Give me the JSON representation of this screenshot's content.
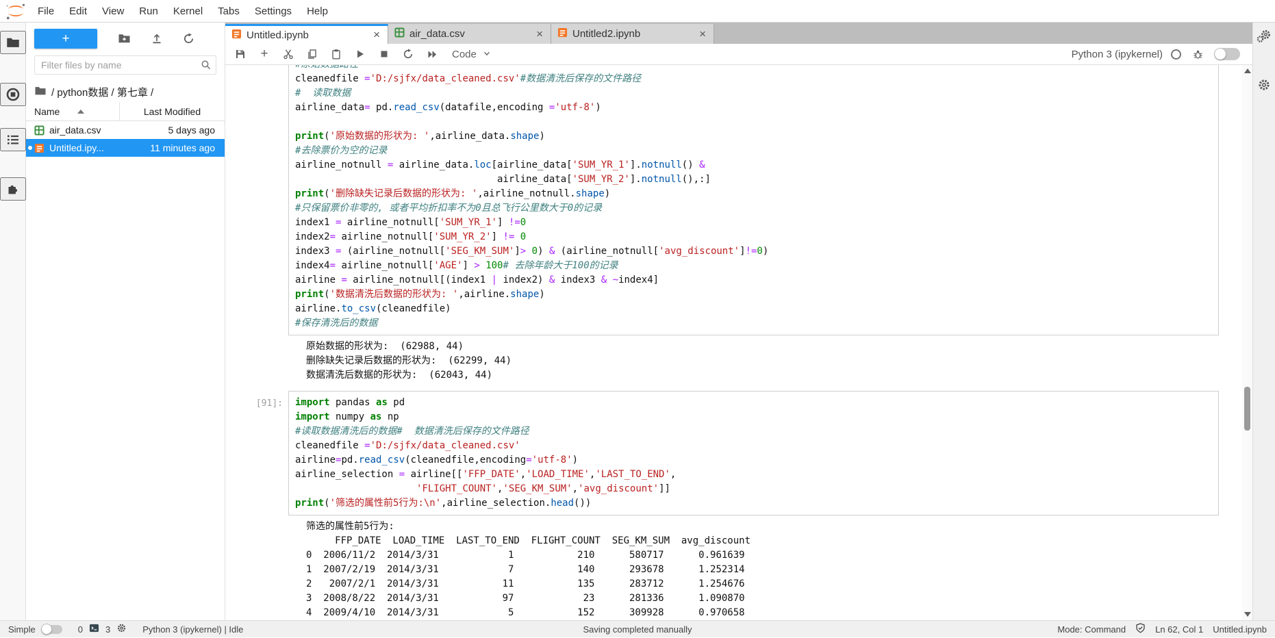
{
  "colors": {
    "accent": "#2196F3",
    "notebook_icon": "#F37626",
    "csv_icon": "#388E3C",
    "kw": "#008000",
    "str": "#BA2121",
    "cmt": "#408080",
    "op": "#AA22FF",
    "num": "#008800",
    "prop": "#0055AA"
  },
  "menu": {
    "items": [
      "File",
      "Edit",
      "View",
      "Run",
      "Kernel",
      "Tabs",
      "Settings",
      "Help"
    ]
  },
  "sidebar": {
    "filter_placeholder": "Filter files by name",
    "breadcrumb": "/ python数据 / 第七章 /",
    "columns": {
      "name": "Name",
      "modified": "Last Modified"
    },
    "files": [
      {
        "name": "air_data.csv",
        "modified": "5 days ago",
        "icon": "csv",
        "selected": false,
        "running": false
      },
      {
        "name": "Untitled.ipy...",
        "modified": "11 minutes ago",
        "icon": "notebook",
        "selected": true,
        "running": true
      }
    ]
  },
  "tabs": [
    {
      "label": "Untitled.ipynb",
      "icon": "notebook",
      "active": true,
      "close": "×"
    },
    {
      "label": "air_data.csv",
      "icon": "csv",
      "active": false,
      "close": "×"
    },
    {
      "label": "Untitled2.ipynb",
      "icon": "notebook",
      "active": false,
      "close": "×"
    }
  ],
  "toolbar": {
    "cell_type": "Code",
    "kernel": "Python 3 (ipykernel)"
  },
  "notebook": {
    "cells": [
      {
        "prompt": "",
        "clip_top": true,
        "lines": [
          [
            [
              "c",
              "#原始数据路径"
            ]
          ],
          [
            [
              "t",
              "cleanedfile "
            ],
            [
              "o",
              "="
            ],
            [
              "s",
              "'D:/sjfx/data_cleaned.csv'"
            ],
            [
              "c",
              "#数据清洗后保存的文件路径"
            ]
          ],
          [
            [
              "c",
              "#  读取数据"
            ]
          ],
          [
            [
              "t",
              "airline_data"
            ],
            [
              "o",
              "="
            ],
            [
              "t",
              " pd."
            ],
            [
              "p",
              "read_csv"
            ],
            [
              "t",
              "(datafile,encoding "
            ],
            [
              "o",
              "="
            ],
            [
              "s",
              "'utf-8'"
            ],
            [
              "t",
              ")"
            ]
          ],
          [
            [
              "t",
              ""
            ]
          ],
          [
            [
              "k",
              "print"
            ],
            [
              "t",
              "("
            ],
            [
              "s",
              "'原始数据的形状为: '"
            ],
            [
              "t",
              ",airline_data."
            ],
            [
              "p",
              "shape"
            ],
            [
              "t",
              ")"
            ]
          ],
          [
            [
              "c",
              "#去除票价为空的记录"
            ]
          ],
          [
            [
              "t",
              "airline_notnull "
            ],
            [
              "o",
              "="
            ],
            [
              "t",
              " airline_data."
            ],
            [
              "p",
              "loc"
            ],
            [
              "t",
              "[airline_data["
            ],
            [
              "s",
              "'SUM_YR_1'"
            ],
            [
              "t",
              "]."
            ],
            [
              "p",
              "notnull"
            ],
            [
              "t",
              "() "
            ],
            [
              "o",
              "&"
            ]
          ],
          [
            [
              "t",
              "                                   airline_data["
            ],
            [
              "s",
              "'SUM_YR_2'"
            ],
            [
              "t",
              "]."
            ],
            [
              "p",
              "notnull"
            ],
            [
              "t",
              "(),:]"
            ]
          ],
          [
            [
              "k",
              "print"
            ],
            [
              "t",
              "("
            ],
            [
              "s",
              "'删除缺失记录后数据的形状为: '"
            ],
            [
              "t",
              ",airline_notnull."
            ],
            [
              "p",
              "shape"
            ],
            [
              "t",
              ")"
            ]
          ],
          [
            [
              "c",
              "#只保留票价非零的, 或者平均折扣率不为0且总飞行公里数大于0的记录"
            ]
          ],
          [
            [
              "t",
              "index1 "
            ],
            [
              "o",
              "="
            ],
            [
              "t",
              " airline_notnull["
            ],
            [
              "s",
              "'SUM_YR_1'"
            ],
            [
              "t",
              "] "
            ],
            [
              "o",
              "!="
            ],
            [
              "n",
              "0"
            ]
          ],
          [
            [
              "t",
              "index2"
            ],
            [
              "o",
              "="
            ],
            [
              "t",
              " airline_notnull["
            ],
            [
              "s",
              "'SUM_YR_2'"
            ],
            [
              "t",
              "] "
            ],
            [
              "o",
              "!="
            ],
            [
              "t",
              " "
            ],
            [
              "n",
              "0"
            ]
          ],
          [
            [
              "t",
              "index3 "
            ],
            [
              "o",
              "="
            ],
            [
              "t",
              " (airline_notnull["
            ],
            [
              "s",
              "'SEG_KM_SUM'"
            ],
            [
              "t",
              "]"
            ],
            [
              "o",
              ">"
            ],
            [
              "t",
              " "
            ],
            [
              "n",
              "0"
            ],
            [
              "t",
              ") "
            ],
            [
              "o",
              "&"
            ],
            [
              "t",
              " (airline_notnull["
            ],
            [
              "s",
              "'avg_discount'"
            ],
            [
              "t",
              "]"
            ],
            [
              "o",
              "!="
            ],
            [
              "n",
              "0"
            ],
            [
              "t",
              ")"
            ]
          ],
          [
            [
              "t",
              "index4"
            ],
            [
              "o",
              "="
            ],
            [
              "t",
              " airline_notnull["
            ],
            [
              "s",
              "'AGE'"
            ],
            [
              "t",
              "] "
            ],
            [
              "o",
              ">"
            ],
            [
              "t",
              " "
            ],
            [
              "n",
              "100"
            ],
            [
              "c",
              "# 去除年龄大于100的记录"
            ]
          ],
          [
            [
              "t",
              "airline "
            ],
            [
              "o",
              "="
            ],
            [
              "t",
              " airline_notnull[(index1 "
            ],
            [
              "o",
              "|"
            ],
            [
              "t",
              " index2) "
            ],
            [
              "o",
              "&"
            ],
            [
              "t",
              " index3 "
            ],
            [
              "o",
              "&"
            ],
            [
              "t",
              " "
            ],
            [
              "o",
              "~"
            ],
            [
              "t",
              "index4]"
            ]
          ],
          [
            [
              "k",
              "print"
            ],
            [
              "t",
              "("
            ],
            [
              "s",
              "'数据清洗后数据的形状为: '"
            ],
            [
              "t",
              ",airline."
            ],
            [
              "p",
              "shape"
            ],
            [
              "t",
              ")"
            ]
          ],
          [
            [
              "t",
              "airline."
            ],
            [
              "p",
              "to_csv"
            ],
            [
              "t",
              "(cleanedfile)"
            ]
          ],
          [
            [
              "c",
              "#保存清洗后的数据"
            ]
          ]
        ],
        "output_lines": [
          "原始数据的形状为:  (62988, 44)",
          "删除缺失记录后数据的形状为:  (62299, 44)",
          "数据清洗后数据的形状为:  (62043, 44)"
        ]
      },
      {
        "prompt": "[91]:",
        "clip_top": false,
        "lines": [
          [
            [
              "k",
              "import"
            ],
            [
              "t",
              " pandas "
            ],
            [
              "k",
              "as"
            ],
            [
              "t",
              " pd"
            ]
          ],
          [
            [
              "k",
              "import"
            ],
            [
              "t",
              " numpy "
            ],
            [
              "k",
              "as"
            ],
            [
              "t",
              " np"
            ]
          ],
          [
            [
              "c",
              "#读取数据清洗后的数据#  数据清洗后保存的文件路径"
            ]
          ],
          [
            [
              "t",
              "cleanedfile "
            ],
            [
              "o",
              "="
            ],
            [
              "s",
              "'D:/sjfx/data_cleaned.csv'"
            ]
          ],
          [
            [
              "t",
              "airline"
            ],
            [
              "o",
              "="
            ],
            [
              "t",
              "pd."
            ],
            [
              "p",
              "read_csv"
            ],
            [
              "t",
              "(cleanedfile,encoding"
            ],
            [
              "o",
              "="
            ],
            [
              "s",
              "'utf-8'"
            ],
            [
              "t",
              ")"
            ]
          ],
          [
            [
              "t",
              "airline_selection "
            ],
            [
              "o",
              "="
            ],
            [
              "t",
              " airline[["
            ],
            [
              "s",
              "'FFP_DATE'"
            ],
            [
              "t",
              ","
            ],
            [
              "s",
              "'LOAD_TIME'"
            ],
            [
              "t",
              ","
            ],
            [
              "s",
              "'LAST_TO_END'"
            ],
            [
              "t",
              ","
            ]
          ],
          [
            [
              "t",
              "                     "
            ],
            [
              "s",
              "'FLIGHT_COUNT'"
            ],
            [
              "t",
              ","
            ],
            [
              "s",
              "'SEG_KM_SUM'"
            ],
            [
              "t",
              ","
            ],
            [
              "s",
              "'avg_discount'"
            ],
            [
              "t",
              "]]"
            ]
          ],
          [
            [
              "k",
              "print"
            ],
            [
              "t",
              "("
            ],
            [
              "s",
              "'筛选的属性前5行为:\\n'"
            ],
            [
              "t",
              ",airline_selection."
            ],
            [
              "p",
              "head"
            ],
            [
              "t",
              "())"
            ]
          ]
        ],
        "output_lines": [
          "筛选的属性前5行为: ",
          "     FFP_DATE  LOAD_TIME  LAST_TO_END  FLIGHT_COUNT  SEG_KM_SUM  avg_discount",
          "0  2006/11/2  2014/3/31            1           210      580717      0.961639",
          "1  2007/2/19  2014/3/31            7           140      293678      1.252314",
          "2   2007/2/1  2014/3/31           11           135      283712      1.254676",
          "3  2008/8/22  2014/3/31           97            23      281336      1.090870",
          "4  2009/4/10  2014/3/31            5           152      309928      0.970658"
        ]
      }
    ]
  },
  "statusbar": {
    "simple_label": "Simple",
    "terminal_count": "0",
    "kernel_count": "3",
    "kernel_status": "Python 3 (ipykernel) | Idle",
    "saving_message": "Saving completed manually",
    "mode_label": "Mode: Command",
    "cursor_position": "Ln 62, Col 1",
    "filename": "Untitled.ipynb"
  }
}
